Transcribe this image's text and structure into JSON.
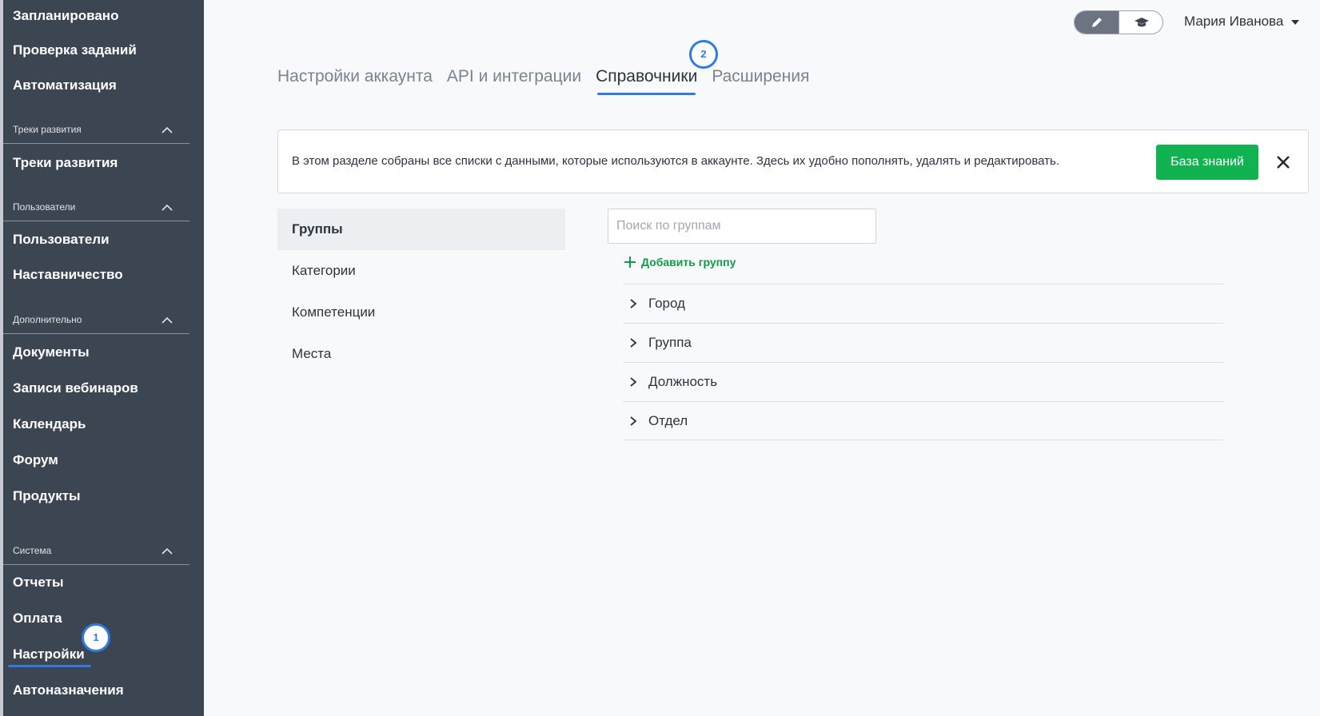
{
  "sidebar": {
    "top_items": [
      "Запланировано",
      "Проверка заданий",
      "Автоматизация"
    ],
    "sections": [
      {
        "title": "Треки развития",
        "items": [
          "Треки развития"
        ]
      },
      {
        "title": "Пользователи",
        "items": [
          "Пользователи",
          "Наставничество"
        ]
      },
      {
        "title": "Дополнительно",
        "items": [
          "Документы",
          "Записи вебинаров",
          "Календарь",
          "Форум",
          "Продукты"
        ]
      },
      {
        "title": "Система",
        "items": [
          "Отчеты",
          "Оплата",
          "Настройки",
          "Автоназначения"
        ]
      }
    ],
    "step_badge": "1"
  },
  "header": {
    "user_name": "Мария Иванова",
    "mode_icons": [
      "pencil-icon",
      "graduation-cap-icon"
    ]
  },
  "tabs": {
    "items": [
      "Настройки аккаунта",
      "API и интеграции",
      "Справочники",
      "Расширения"
    ],
    "active": "Справочники",
    "step_badge": "2"
  },
  "banner": {
    "text": "В этом разделе собраны все списки с данными, которые используются в аккаунте. Здесь их удобно пополнять, удалять и редактировать.",
    "button_label": "База знаний"
  },
  "dictionaries": {
    "items": [
      "Группы",
      "Категории",
      "Компетенции",
      "Места"
    ],
    "active": "Группы"
  },
  "groups": {
    "search_placeholder": "Поиск по группам",
    "add_label": "Добавить группу",
    "rows": [
      "Город",
      "Группа",
      "Должность",
      "Отдел"
    ]
  },
  "colors": {
    "sidebar_bg": "#3c4653",
    "accent_blue": "#2f7ae5",
    "primary_green": "#10b350"
  }
}
